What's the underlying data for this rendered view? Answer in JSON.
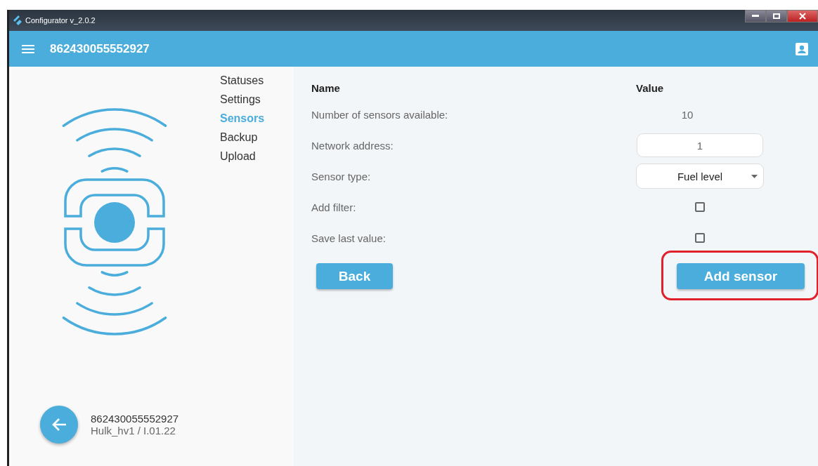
{
  "window": {
    "title": "Configurator v_2.0.2"
  },
  "app_bar": {
    "title": "862430055552927"
  },
  "nav": [
    {
      "label": "Statuses",
      "selected": false
    },
    {
      "label": "Settings",
      "selected": false
    },
    {
      "label": "Sensors",
      "selected": true
    },
    {
      "label": "Backup",
      "selected": false
    },
    {
      "label": "Upload",
      "selected": false
    }
  ],
  "device": {
    "id": "862430055552927",
    "model": "Hulk_hv1 / I.01.22"
  },
  "table": {
    "columns": [
      "Name",
      "Value"
    ],
    "rows": [
      {
        "kind": "text",
        "name": "Number of sensors available:",
        "value": "10"
      },
      {
        "kind": "input",
        "name": "Network address:",
        "value": "1"
      },
      {
        "kind": "select",
        "name": "Sensor type:",
        "value": "Fuel level"
      },
      {
        "kind": "checkbox",
        "name": "Add filter:",
        "checked": false
      },
      {
        "kind": "checkbox",
        "name": "Save last value:",
        "checked": false
      }
    ]
  },
  "buttons": [
    {
      "label": "Back",
      "highlighted": false
    },
    {
      "label": "Add sensor",
      "highlighted": true
    }
  ]
}
